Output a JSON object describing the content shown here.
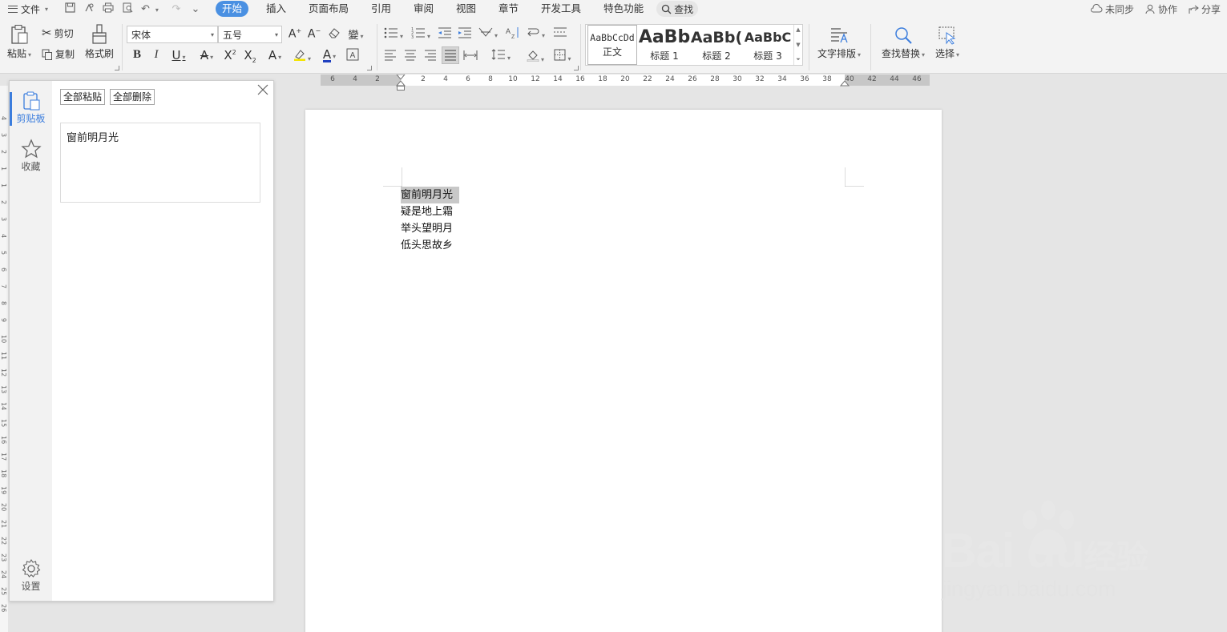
{
  "menubar": {
    "file_label": "文件",
    "tabs": [
      "开始",
      "插入",
      "页面布局",
      "引用",
      "审阅",
      "视图",
      "章节",
      "开发工具",
      "特色功能"
    ],
    "search_label": "查找",
    "right": {
      "sync": "未同步",
      "collab": "协作",
      "share": "分享"
    }
  },
  "ribbon": {
    "paste": "粘贴",
    "cut": "剪切",
    "copy": "复制",
    "format_painter": "格式刷",
    "font_name": "宋体",
    "font_size": "五号",
    "styles": [
      {
        "sample": "AaBbCcDd",
        "name": "正文"
      },
      {
        "sample": "AaBb",
        "name": "标题 1"
      },
      {
        "sample": "AaBb(",
        "name": "标题 2"
      },
      {
        "sample": "AaBbC",
        "name": "标题 3"
      }
    ],
    "text_layout": "文字排版",
    "find_replace": "查找替换",
    "select": "选择"
  },
  "ruler": {
    "h_ticks": [
      "6",
      "4",
      "2",
      "2",
      "4",
      "6",
      "8",
      "10",
      "12",
      "14",
      "16",
      "18",
      "20",
      "22",
      "24",
      "26",
      "28",
      "30",
      "32",
      "34",
      "36",
      "38",
      "40",
      "42",
      "44",
      "46"
    ],
    "v_ticks": [
      "4",
      "3",
      "2",
      "1",
      "1",
      "2",
      "3",
      "4",
      "5",
      "6",
      "7",
      "8",
      "9",
      "10",
      "11",
      "12",
      "13",
      "14",
      "15",
      "16",
      "17",
      "18",
      "19",
      "20",
      "21",
      "22",
      "23",
      "24",
      "25",
      "26"
    ]
  },
  "side_panel": {
    "rail": {
      "clipboard": "剪贴板",
      "favorites": "收藏",
      "settings": "设置"
    },
    "paste_all": "全部粘贴",
    "delete_all": "全部删除",
    "clip_items": [
      "窗前明月光"
    ]
  },
  "document": {
    "lines": [
      "窗前明月光",
      "疑是地上霜",
      "举头望明月",
      "低头思故乡"
    ]
  },
  "watermark": {
    "brand": "Bai du",
    "cn": "经验",
    "url": "jingyan.baidu.com"
  },
  "colors": {
    "accent": "#4a90e2",
    "panel_accent": "#3b7ddd",
    "selection": "#c8c8c8",
    "font_color_underline": "#1f3fbf",
    "highlight_underline": "#f3e400"
  }
}
